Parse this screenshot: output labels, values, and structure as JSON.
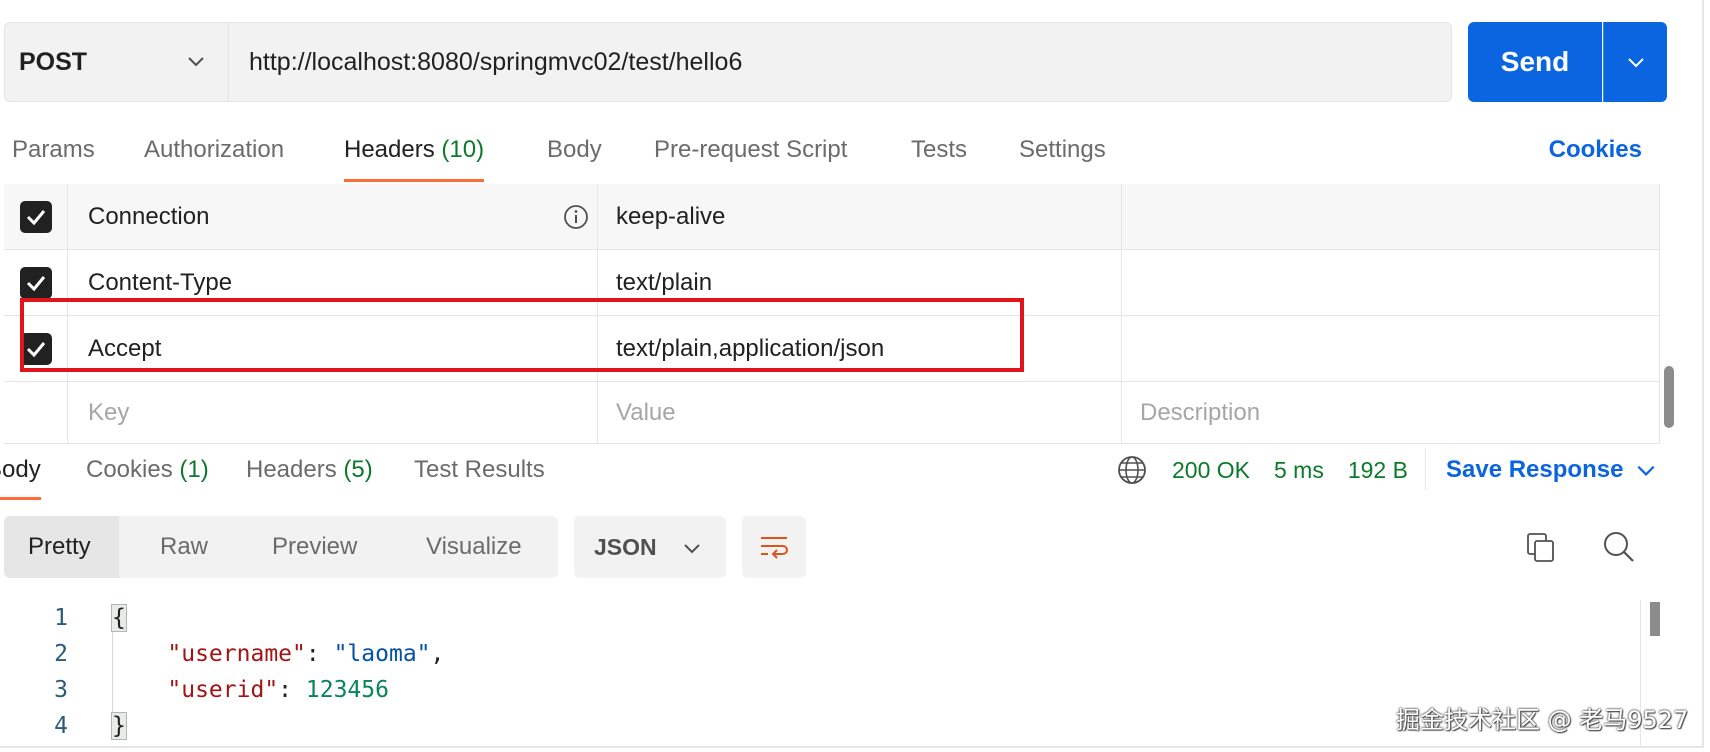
{
  "request": {
    "method": "POST",
    "url": "http://localhost:8080/springmvc02/test/hello6",
    "send_label": "Send"
  },
  "req_tabs": {
    "params": "Params",
    "authorization": "Authorization",
    "headers": "Headers",
    "headers_count": "(10)",
    "body": "Body",
    "prerequest": "Pre-request Script",
    "tests": "Tests",
    "settings": "Settings",
    "cookies": "Cookies"
  },
  "headers": {
    "rows": [
      {
        "checked": true,
        "key": "Connection",
        "value": "keep-alive",
        "description": ""
      },
      {
        "checked": true,
        "key": "Content-Type",
        "value": "text/plain",
        "description": ""
      },
      {
        "checked": true,
        "key": "Accept",
        "value": "text/plain,application/json",
        "description": ""
      }
    ],
    "placeholder_key": "Key",
    "placeholder_value": "Value",
    "placeholder_description": "Description"
  },
  "response": {
    "tabs": {
      "body": "Body",
      "cookies": "Cookies",
      "cookies_count": "(1)",
      "headers": "Headers",
      "headers_count": "(5)",
      "test_results": "Test Results"
    },
    "status": "200 OK",
    "time": "5 ms",
    "size": "192 B",
    "save_label": "Save Response",
    "views": [
      "Pretty",
      "Raw",
      "Preview",
      "Visualize"
    ],
    "format": "JSON",
    "code_lines": [
      "1",
      "2",
      "3",
      "4"
    ],
    "json": {
      "open": "{",
      "k1": "\"username\"",
      "v1": "\"laoma\"",
      "k2": "\"userid\"",
      "v2": "123456",
      "close": "}"
    }
  },
  "watermark": "掘金技术社区 @ 老马9527",
  "colors": {
    "accent_blue": "#0b65e1",
    "active_tab_underline": "#ff6c37",
    "status_green": "#0b7a2c",
    "highlight_red": "#e0141b"
  }
}
